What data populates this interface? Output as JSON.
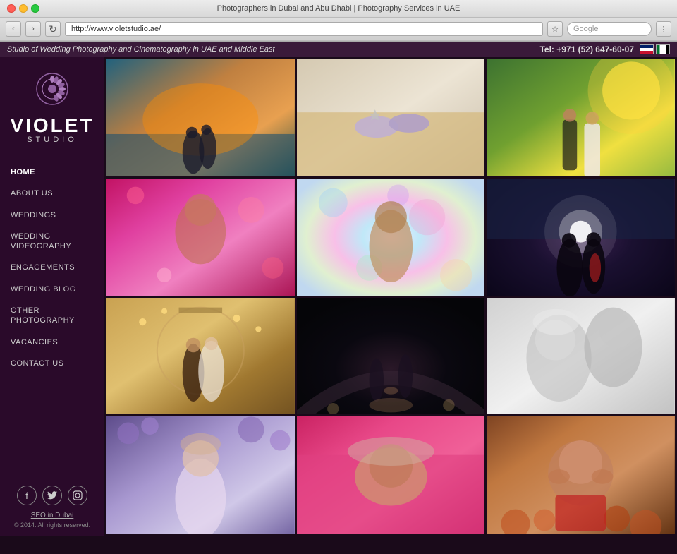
{
  "browser": {
    "title": "Photographers in Dubai and Abu Dhabi | Photography Services in UAE",
    "url": "http://www.violetstudio.ae/",
    "search_placeholder": "Google",
    "nav_back": "‹",
    "nav_forward": "›",
    "reload": "↻"
  },
  "site": {
    "banner_text": "Studio of Wedding Photography and Cinematography in UAE and Middle East",
    "tel_label": "Tel: +971 (52) 647-60-07"
  },
  "logo": {
    "name_top": "VIOLET",
    "name_bottom": "STUDIO"
  },
  "nav": {
    "items": [
      {
        "label": "HOME",
        "active": true
      },
      {
        "label": "ABOUT US",
        "active": false
      },
      {
        "label": "WEDDINGS",
        "active": false
      },
      {
        "label": "WEDDING\nVIDEOGRAPHY",
        "active": false
      },
      {
        "label": "ENGAGEMENTS",
        "active": false
      },
      {
        "label": "WEDDING BLOG",
        "active": false
      },
      {
        "label": "OTHER\nPHOTOGRAPHY",
        "active": false
      },
      {
        "label": "VACANCIES",
        "active": false
      },
      {
        "label": "CONTACT US",
        "active": false
      }
    ]
  },
  "social": {
    "facebook": "f",
    "twitter": "t",
    "instagram": "📷"
  },
  "footer": {
    "seo_link": "SEO in Dubai",
    "copyright": "© 2014. All rights reserved."
  },
  "photos": [
    {
      "id": 1,
      "desc": "Couple by sea at sunset"
    },
    {
      "id": 2,
      "desc": "Wedding shoes on sand"
    },
    {
      "id": 3,
      "desc": "Bride and groom from behind in park"
    },
    {
      "id": 4,
      "desc": "Indian bride in pink"
    },
    {
      "id": 5,
      "desc": "Indian groom colorful bokeh"
    },
    {
      "id": 6,
      "desc": "Couple silhouette at night"
    },
    {
      "id": 7,
      "desc": "Couple at carousel"
    },
    {
      "id": 8,
      "desc": "Dancers in dark cave"
    },
    {
      "id": 9,
      "desc": "Couple black and white"
    },
    {
      "id": 10,
      "desc": "Blonde in garden"
    },
    {
      "id": 11,
      "desc": "Woman lying in pink"
    },
    {
      "id": 12,
      "desc": "Child smiling in autumn"
    }
  ]
}
